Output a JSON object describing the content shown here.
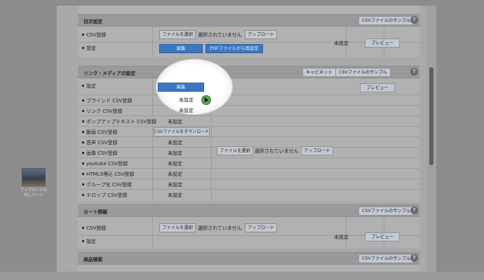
{
  "desktop": {
    "icon_caption": "アップロードお試しページ"
  },
  "sections": {
    "toc": {
      "title": "目次設定",
      "csv_sample": "CSVファイルのサンプル",
      "help": "?",
      "row1_label": "CSV登録",
      "row2_label": "設定",
      "file_select": "ファイルを選択",
      "no_file": "選択されていません",
      "upload": "アップロード",
      "edit": "編集",
      "pdf_reset": "PDFファイルから再設定",
      "status": "未設定",
      "preview": "プレビュー"
    },
    "links": {
      "title": "リンク・メディアの設定",
      "cabinet": "キャビネット",
      "csv_sample": "CSVファイルのサンプル",
      "help": "?",
      "settings_label": "設定",
      "edit": "編集",
      "preview": "プレビュー",
      "file_select": "ファイルを選択",
      "no_file": "選択されていません",
      "upload": "アップロード",
      "items": [
        {
          "label": "ブラインド CSV登録",
          "value": "未設定"
        },
        {
          "label": "リンク CSV登録",
          "value": "未設定"
        },
        {
          "label": "ポップアップテキスト CSV登録",
          "value": "未設定"
        },
        {
          "label": "動画 CSV登録",
          "value": "CSVファイルをダウンロード"
        },
        {
          "label": "音声 CSV登録",
          "value": "未設定"
        },
        {
          "label": "画像 CSV登録",
          "value": "未設定"
        },
        {
          "label": "youtube CSV登録",
          "value": "未設定"
        },
        {
          "label": "HTML5埋込 CSV登録",
          "value": "未設定"
        },
        {
          "label": "グループ化 CSV登録",
          "value": "未設定"
        },
        {
          "label": "テロップ CSV登録",
          "value": "未設定"
        }
      ]
    },
    "cart": {
      "title": "カート情報",
      "csv_sample": "CSVファイルのサンプル",
      "help": "?",
      "row1_label": "CSV登録",
      "row2_label": "設定",
      "file_select": "ファイルを選択",
      "no_file": "選択されていません",
      "upload": "アップロード",
      "status": "未設定",
      "preview": "プレビュー"
    },
    "search": {
      "title": "商品検索",
      "csv_sample": "CSVファイルのサンプル",
      "help": "?"
    }
  },
  "colors": {
    "primary_button": "#3c78c2",
    "overlay_gray": "#8d8d8d",
    "cursor_ring": "#63a15b"
  }
}
